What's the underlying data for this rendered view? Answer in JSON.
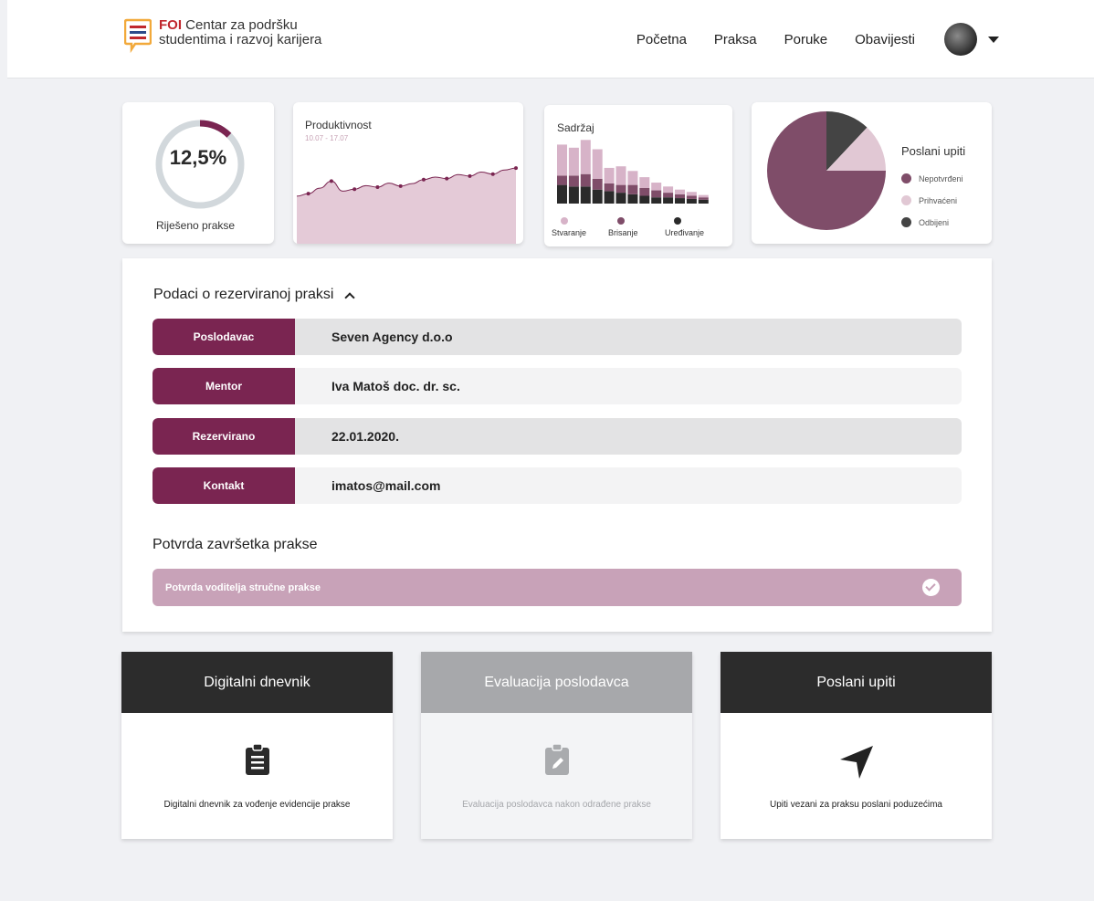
{
  "header": {
    "logo_bold": "FOI",
    "logo_line1": "Centar za podršku",
    "logo_line2": "studentima i razvoj karijera",
    "nav": [
      "Početna",
      "Praksa",
      "Poruke",
      "Obavijesti"
    ]
  },
  "colors": {
    "primary": "#7a2551",
    "pie_main": "#7f4d69",
    "pie_accepted": "#e1c8d4",
    "pie_rejected": "#444444",
    "confirm_bg": "#c8a2b8",
    "dark_header": "#2c2c2c",
    "disabled_header": "#a7a8ab"
  },
  "ring_card": {
    "value": "12,5%",
    "label": "Riješeno prakse",
    "fraction": 0.125
  },
  "productivity_card": {
    "title": "Produktivnost",
    "date_range": "10.07 - 17.07"
  },
  "content_card": {
    "title": "Sadržaj",
    "legend": [
      "Stvaranje",
      "Brisanje",
      "Uređivanje"
    ]
  },
  "inquiries_card": {
    "title": "Poslani upiti",
    "legend": [
      "Nepotvrđeni",
      "Prihvaćeni",
      "Odbijeni"
    ]
  },
  "details": {
    "title": "Podaci o rezerviranoj praksi",
    "rows": [
      {
        "label": "Poslodavac",
        "value": "Seven Agency d.o.o"
      },
      {
        "label": "Mentor",
        "value": "Iva Matoš doc. dr. sc."
      },
      {
        "label": "Rezervirano",
        "value": "22.01.2020."
      },
      {
        "label": "Kontakt",
        "value": "imatos@mail.com"
      }
    ],
    "confirm_section_title": "Potvrda završetka prakse",
    "confirm_item": "Potvrda voditelja stručne prakse"
  },
  "bottom_cards": [
    {
      "title": "Digitalni dnevnik",
      "text": "Digitalni dnevnik za vođenje evidencije prakse"
    },
    {
      "title": "Evaluacija poslodavca",
      "text": "Evaluacija poslodavca nakon odrađene prakse"
    },
    {
      "title": "Poslani upiti",
      "text": "Upiti vezani za praksu poslani poduzećima"
    }
  ],
  "chart_data": [
    {
      "type": "area",
      "title": "Produktivnost",
      "subtitle": "10.07 - 17.07",
      "values": [
        0.22,
        0.27,
        0.38,
        0.52,
        0.32,
        0.36,
        0.43,
        0.4,
        0.48,
        0.42,
        0.47,
        0.55,
        0.6,
        0.57,
        0.65,
        0.62,
        0.7,
        0.66,
        0.74,
        0.78
      ],
      "ylim": [
        0,
        1
      ]
    },
    {
      "type": "bar",
      "title": "Sadržaj",
      "stacked": true,
      "series": [
        {
          "name": "Stvaranje",
          "values": [
            40,
            36,
            44,
            38,
            20,
            24,
            18,
            14,
            10,
            8,
            6,
            5,
            3
          ]
        },
        {
          "name": "Brisanje",
          "values": [
            12,
            14,
            16,
            14,
            10,
            10,
            12,
            10,
            9,
            6,
            5,
            4,
            3
          ]
        },
        {
          "name": "Uređivanje",
          "values": [
            24,
            22,
            22,
            18,
            16,
            14,
            12,
            10,
            8,
            8,
            7,
            6,
            5
          ]
        }
      ]
    },
    {
      "type": "pie",
      "title": "Poslani upiti",
      "categories": [
        "Nepotvrđeni",
        "Prihvaćeni",
        "Odbijeni"
      ],
      "values": [
        75,
        13,
        12
      ]
    }
  ]
}
